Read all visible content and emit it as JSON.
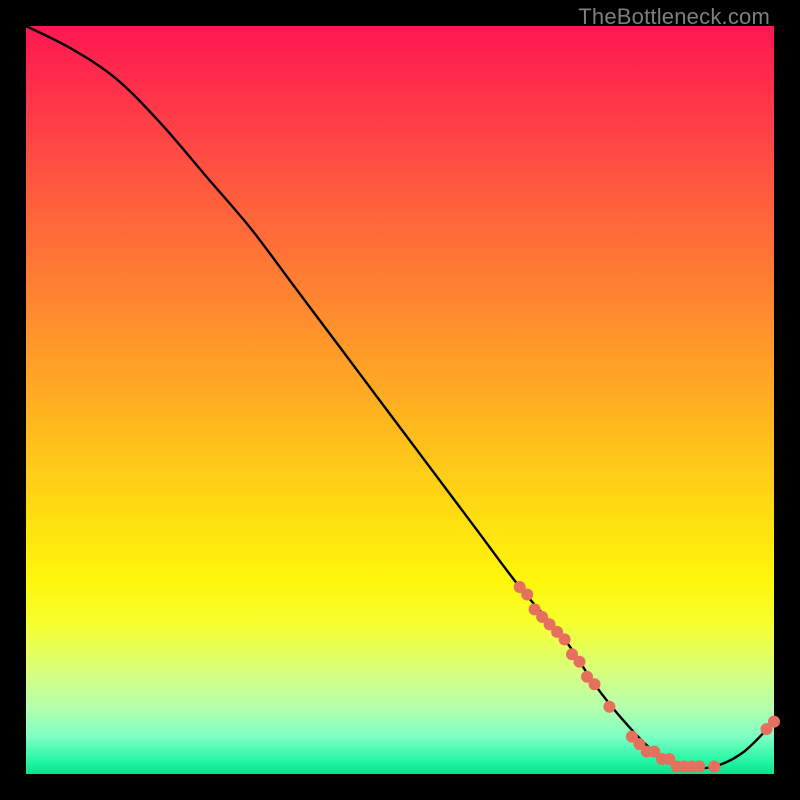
{
  "watermark": "TheBottleneck.com",
  "chart_data": {
    "type": "line",
    "title": "",
    "xlabel": "",
    "ylabel": "",
    "xlim": [
      0,
      100
    ],
    "ylim": [
      0,
      100
    ],
    "series": [
      {
        "name": "bottleneck-curve",
        "x": [
          0,
          6,
          12,
          18,
          24,
          30,
          36,
          42,
          48,
          54,
          60,
          66,
          72,
          76,
          80,
          84,
          88,
          92,
          96,
          100
        ],
        "y": [
          100,
          97,
          93,
          87,
          80,
          73,
          65,
          57,
          49,
          41,
          33,
          25,
          18,
          12,
          7,
          3,
          1,
          1,
          3,
          7
        ]
      }
    ],
    "markers": {
      "name": "highlighted-points",
      "color": "#e6705e",
      "x": [
        66,
        67,
        68,
        69,
        70,
        71,
        72,
        73,
        74,
        75,
        76,
        78,
        81,
        82,
        83,
        84,
        85,
        86,
        87,
        88,
        89,
        90,
        92,
        99,
        100
      ],
      "y": [
        25,
        24,
        22,
        21,
        20,
        19,
        18,
        16,
        15,
        13,
        12,
        9,
        5,
        4,
        3,
        3,
        2,
        2,
        1,
        1,
        1,
        1,
        1,
        6,
        7
      ]
    }
  }
}
